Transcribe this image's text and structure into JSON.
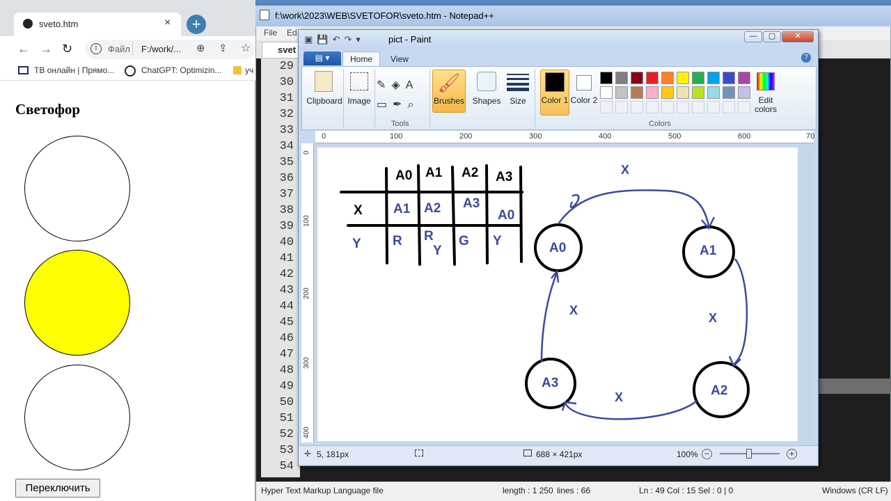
{
  "chrome": {
    "tab_title": "sveto.htm",
    "tab_close": "×",
    "new_tab": "+",
    "nav": {
      "back": "←",
      "forward": "→",
      "reload": "↻"
    },
    "omnibox": {
      "scheme": "Файл",
      "url": "F:/work/..."
    },
    "bookmarks": [
      "ТВ онлайн | Прямо...",
      "ChatGPT: Optimizin...",
      "уч"
    ],
    "page": {
      "heading": "Светофор",
      "lights": [
        {
          "name": "red",
          "color": "#ffffff"
        },
        {
          "name": "yellow",
          "color": "#ffff00"
        },
        {
          "name": "green",
          "color": "#ffffff"
        }
      ],
      "button_label": "Переключить"
    }
  },
  "notepad": {
    "title": "f:\\work\\2023\\WEB\\SVETOFOR\\sveto.htm - Notepad++",
    "menu": [
      "File",
      "Ed"
    ],
    "tab_label": "svet",
    "line_numbers": [
      "29",
      "30",
      "31",
      "32",
      "33",
      "34",
      "35",
      "36",
      "37",
      "38",
      "39",
      "40",
      "41",
      "42",
      "43",
      "44",
      "45",
      "46",
      "47",
      "48",
      "49",
      "50",
      "51",
      "52",
      "53",
      "54"
    ],
    "status": {
      "file_type": "Hyper Text Markup Language file",
      "length": "length : 1 250",
      "lines": "lines : 66",
      "position": "Ln : 49    Col : 15    Sel : 0 | 0",
      "eol": "Windows (CR LF)"
    }
  },
  "paint": {
    "title": "pict - Paint",
    "window_buttons": {
      "min": "—",
      "max": "▢",
      "close": "✕"
    },
    "tabs": {
      "home": "Home",
      "view": "View"
    },
    "ribbon": {
      "clipboard": "Clipboard",
      "image": "Image",
      "tools": "Tools",
      "brushes": "Brushes",
      "shapes": "Shapes",
      "size": "Size",
      "color1": "Color 1",
      "color2": "Color 2",
      "colors": "Colors",
      "edit_colors": "Edit colors"
    },
    "palette_row1": [
      "#000000",
      "#7f7f7f",
      "#880015",
      "#ed1c24",
      "#ff7f27",
      "#fff200",
      "#22b14c",
      "#00a2e8",
      "#3f48cc",
      "#a349a4"
    ],
    "palette_row2": [
      "#ffffff",
      "#c3c3c3",
      "#b97a57",
      "#ffaec9",
      "#ffc90e",
      "#efe4b0",
      "#b5e61d",
      "#99d9ea",
      "#7092be",
      "#c8bfe7"
    ],
    "ruler_h": [
      "0",
      "100",
      "200",
      "300",
      "400",
      "500",
      "600",
      "70"
    ],
    "ruler_v": [
      "0",
      "100",
      "200",
      "300",
      "400"
    ],
    "status": {
      "position": "5, 181px",
      "size": "688 × 421px",
      "zoom": "100%",
      "zoom_level": 1.0
    },
    "drawing": {
      "table_headers": [
        "A0",
        "A1",
        "A2",
        "A3"
      ],
      "row_x_label": "X",
      "row_x_values": [
        "A1",
        "A2",
        "A3",
        "A0"
      ],
      "row_y_label": "Y",
      "row_y_values": [
        "R",
        "R",
        "Y",
        "G",
        "Y"
      ],
      "states": [
        "A0",
        "A1",
        "A2",
        "A3"
      ],
      "edge_label": "X",
      "ink_black": "#000000",
      "ink_blue": "#3b4a9e"
    }
  }
}
